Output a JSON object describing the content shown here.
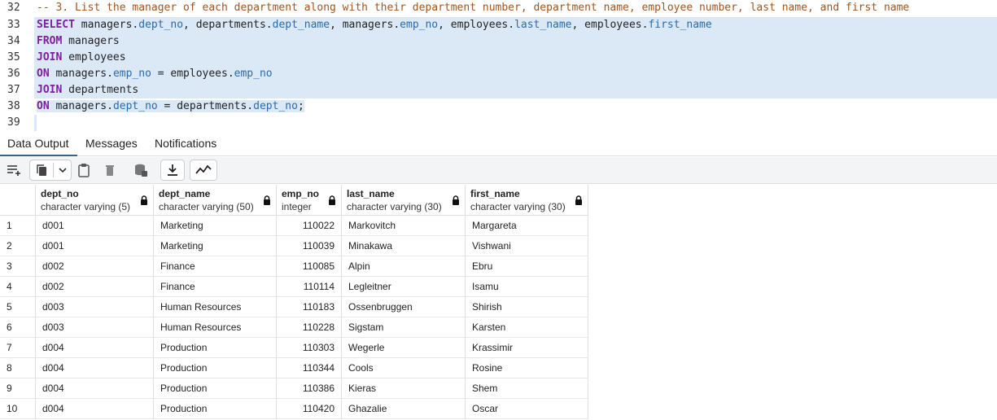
{
  "editor": {
    "lines": [
      {
        "num": "32",
        "comment": "-- 3. List the manager of each department along with their department number, department name, employee number, last name, and first name"
      },
      {
        "num": "33",
        "kw": "SELECT",
        "t1": " managers.",
        "c1": "dept_no",
        "t2": ", departments.",
        "c2": "dept_name",
        "t3": ", managers.",
        "c3": "emp_no",
        "t4": ", employees.",
        "c4": "last_name",
        "t5": ", employees.",
        "c5": "first_name"
      },
      {
        "num": "34",
        "kw": "FROM",
        "t1": " managers"
      },
      {
        "num": "35",
        "kw": "JOIN",
        "t1": " employees"
      },
      {
        "num": "36",
        "kw": "ON",
        "t1": " managers.",
        "c1": "emp_no",
        "t2": " = employees.",
        "c2": "emp_no"
      },
      {
        "num": "37",
        "kw": "JOIN",
        "t1": " departments"
      },
      {
        "num": "38",
        "kw": "ON",
        "t1": " managers.",
        "c1": "dept_no",
        "t2": " = departments.",
        "c2": "dept_no",
        "t3": ";"
      },
      {
        "num": "39"
      }
    ]
  },
  "tabs": [
    {
      "label": "Data Output",
      "active": true
    },
    {
      "label": "Messages",
      "active": false
    },
    {
      "label": "Notifications",
      "active": false
    }
  ],
  "toolbar": {
    "icons": [
      "add-row-icon",
      "copy-icon",
      "chevron-down-icon",
      "paste-icon",
      "delete-icon",
      "save-data-icon",
      "download-icon",
      "graph-icon"
    ]
  },
  "grid": {
    "columns": [
      {
        "name": "dept_no",
        "type": "character varying (5)"
      },
      {
        "name": "dept_name",
        "type": "character varying (50)"
      },
      {
        "name": "emp_no",
        "type": "integer"
      },
      {
        "name": "last_name",
        "type": "character varying (30)"
      },
      {
        "name": "first_name",
        "type": "character varying (30)"
      }
    ],
    "rows": [
      {
        "n": "1",
        "dept_no": "d001",
        "dept_name": "Marketing",
        "emp_no": "110022",
        "last_name": "Markovitch",
        "first_name": "Margareta"
      },
      {
        "n": "2",
        "dept_no": "d001",
        "dept_name": "Marketing",
        "emp_no": "110039",
        "last_name": "Minakawa",
        "first_name": "Vishwani"
      },
      {
        "n": "3",
        "dept_no": "d002",
        "dept_name": "Finance",
        "emp_no": "110085",
        "last_name": "Alpin",
        "first_name": "Ebru"
      },
      {
        "n": "4",
        "dept_no": "d002",
        "dept_name": "Finance",
        "emp_no": "110114",
        "last_name": "Legleitner",
        "first_name": "Isamu"
      },
      {
        "n": "5",
        "dept_no": "d003",
        "dept_name": "Human Resources",
        "emp_no": "110183",
        "last_name": "Ossenbruggen",
        "first_name": "Shirish"
      },
      {
        "n": "6",
        "dept_no": "d003",
        "dept_name": "Human Resources",
        "emp_no": "110228",
        "last_name": "Sigstam",
        "first_name": "Karsten"
      },
      {
        "n": "7",
        "dept_no": "d004",
        "dept_name": "Production",
        "emp_no": "110303",
        "last_name": "Wegerle",
        "first_name": "Krassimir"
      },
      {
        "n": "8",
        "dept_no": "d004",
        "dept_name": "Production",
        "emp_no": "110344",
        "last_name": "Cools",
        "first_name": "Rosine"
      },
      {
        "n": "9",
        "dept_no": "d004",
        "dept_name": "Production",
        "emp_no": "110386",
        "last_name": "Kieras",
        "first_name": "Shem"
      },
      {
        "n": "10",
        "dept_no": "d004",
        "dept_name": "Production",
        "emp_no": "110420",
        "last_name": "Ghazalie",
        "first_name": "Oscar"
      }
    ]
  }
}
